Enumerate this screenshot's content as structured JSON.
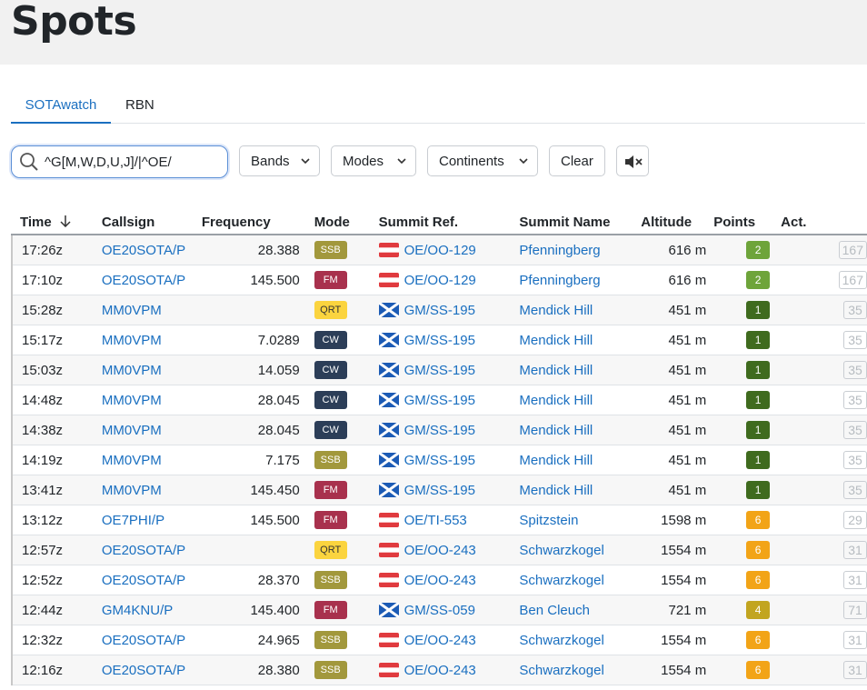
{
  "page": {
    "title": "Spots"
  },
  "tabs": [
    {
      "label": "SOTAwatch",
      "active": true
    },
    {
      "label": "RBN",
      "active": false
    }
  ],
  "filters": {
    "search_value": "^G[M,W,D,U,J]/|^OE/",
    "bands_label": "Bands",
    "modes_label": "Modes",
    "continents_label": "Continents",
    "clear_label": "Clear",
    "mute_icon": "speaker-muted-icon"
  },
  "table": {
    "columns": [
      "Time",
      "Callsign",
      "Frequency",
      "Mode",
      "Summit Ref.",
      "Summit Name",
      "Altitude",
      "Points",
      "Act."
    ],
    "sort_icon": "arrow-down-icon",
    "rows": [
      {
        "time": "17:26z",
        "callsign": "OE20SOTA/P",
        "freq": "28.388",
        "mode": "SSB",
        "flag": "austria",
        "ref": "OE/OO-129",
        "name": "Pfenningberg",
        "alt": "616 m",
        "points": "2",
        "act": "167"
      },
      {
        "time": "17:10z",
        "callsign": "OE20SOTA/P",
        "freq": "145.500",
        "mode": "FM",
        "flag": "austria",
        "ref": "OE/OO-129",
        "name": "Pfenningberg",
        "alt": "616 m",
        "points": "2",
        "act": "167"
      },
      {
        "time": "15:28z",
        "callsign": "MM0VPM",
        "freq": "",
        "mode": "QRT",
        "flag": "scotland",
        "ref": "GM/SS-195",
        "name": "Mendick Hill",
        "alt": "451 m",
        "points": "1",
        "act": "35"
      },
      {
        "time": "15:17z",
        "callsign": "MM0VPM",
        "freq": "7.0289",
        "mode": "CW",
        "flag": "scotland",
        "ref": "GM/SS-195",
        "name": "Mendick Hill",
        "alt": "451 m",
        "points": "1",
        "act": "35"
      },
      {
        "time": "15:03z",
        "callsign": "MM0VPM",
        "freq": "14.059",
        "mode": "CW",
        "flag": "scotland",
        "ref": "GM/SS-195",
        "name": "Mendick Hill",
        "alt": "451 m",
        "points": "1",
        "act": "35"
      },
      {
        "time": "14:48z",
        "callsign": "MM0VPM",
        "freq": "28.045",
        "mode": "CW",
        "flag": "scotland",
        "ref": "GM/SS-195",
        "name": "Mendick Hill",
        "alt": "451 m",
        "points": "1",
        "act": "35"
      },
      {
        "time": "14:38z",
        "callsign": "MM0VPM",
        "freq": "28.045",
        "mode": "CW",
        "flag": "scotland",
        "ref": "GM/SS-195",
        "name": "Mendick Hill",
        "alt": "451 m",
        "points": "1",
        "act": "35"
      },
      {
        "time": "14:19z",
        "callsign": "MM0VPM",
        "freq": "7.175",
        "mode": "SSB",
        "flag": "scotland",
        "ref": "GM/SS-195",
        "name": "Mendick Hill",
        "alt": "451 m",
        "points": "1",
        "act": "35"
      },
      {
        "time": "13:41z",
        "callsign": "MM0VPM",
        "freq": "145.450",
        "mode": "FM",
        "flag": "scotland",
        "ref": "GM/SS-195",
        "name": "Mendick Hill",
        "alt": "451 m",
        "points": "1",
        "act": "35"
      },
      {
        "time": "13:12z",
        "callsign": "OE7PHI/P",
        "freq": "145.500",
        "mode": "FM",
        "flag": "austria",
        "ref": "OE/TI-553",
        "name": "Spitzstein",
        "alt": "1598 m",
        "points": "6",
        "act": "29"
      },
      {
        "time": "12:57z",
        "callsign": "OE20SOTA/P",
        "freq": "",
        "mode": "QRT",
        "flag": "austria",
        "ref": "OE/OO-243",
        "name": "Schwarzkogel",
        "alt": "1554 m",
        "points": "6",
        "act": "31"
      },
      {
        "time": "12:52z",
        "callsign": "OE20SOTA/P",
        "freq": "28.370",
        "mode": "SSB",
        "flag": "austria",
        "ref": "OE/OO-243",
        "name": "Schwarzkogel",
        "alt": "1554 m",
        "points": "6",
        "act": "31"
      },
      {
        "time": "12:44z",
        "callsign": "GM4KNU/P",
        "freq": "145.400",
        "mode": "FM",
        "flag": "scotland",
        "ref": "GM/SS-059",
        "name": "Ben Cleuch",
        "alt": "721 m",
        "points": "4",
        "act": "71"
      },
      {
        "time": "12:32z",
        "callsign": "OE20SOTA/P",
        "freq": "24.965",
        "mode": "SSB",
        "flag": "austria",
        "ref": "OE/OO-243",
        "name": "Schwarzkogel",
        "alt": "1554 m",
        "points": "6",
        "act": "31"
      },
      {
        "time": "12:16z",
        "callsign": "OE20SOTA/P",
        "freq": "28.380",
        "mode": "SSB",
        "flag": "austria",
        "ref": "OE/OO-243",
        "name": "Schwarzkogel",
        "alt": "1554 m",
        "points": "6",
        "act": "31"
      }
    ]
  },
  "colors": {
    "link": "#1a6fc0",
    "mode_SSB": "#a2983c",
    "mode_FM": "#a8314d",
    "mode_CW": "#2c3e58",
    "mode_QRT": "#fbd43f",
    "points_1": "#3f6b1e",
    "points_2": "#6ea43a",
    "points_4": "#c2a520",
    "points_6": "#f2a417",
    "austria_red": "#e03a3e",
    "scotland_blue": "#1c5bb5"
  }
}
